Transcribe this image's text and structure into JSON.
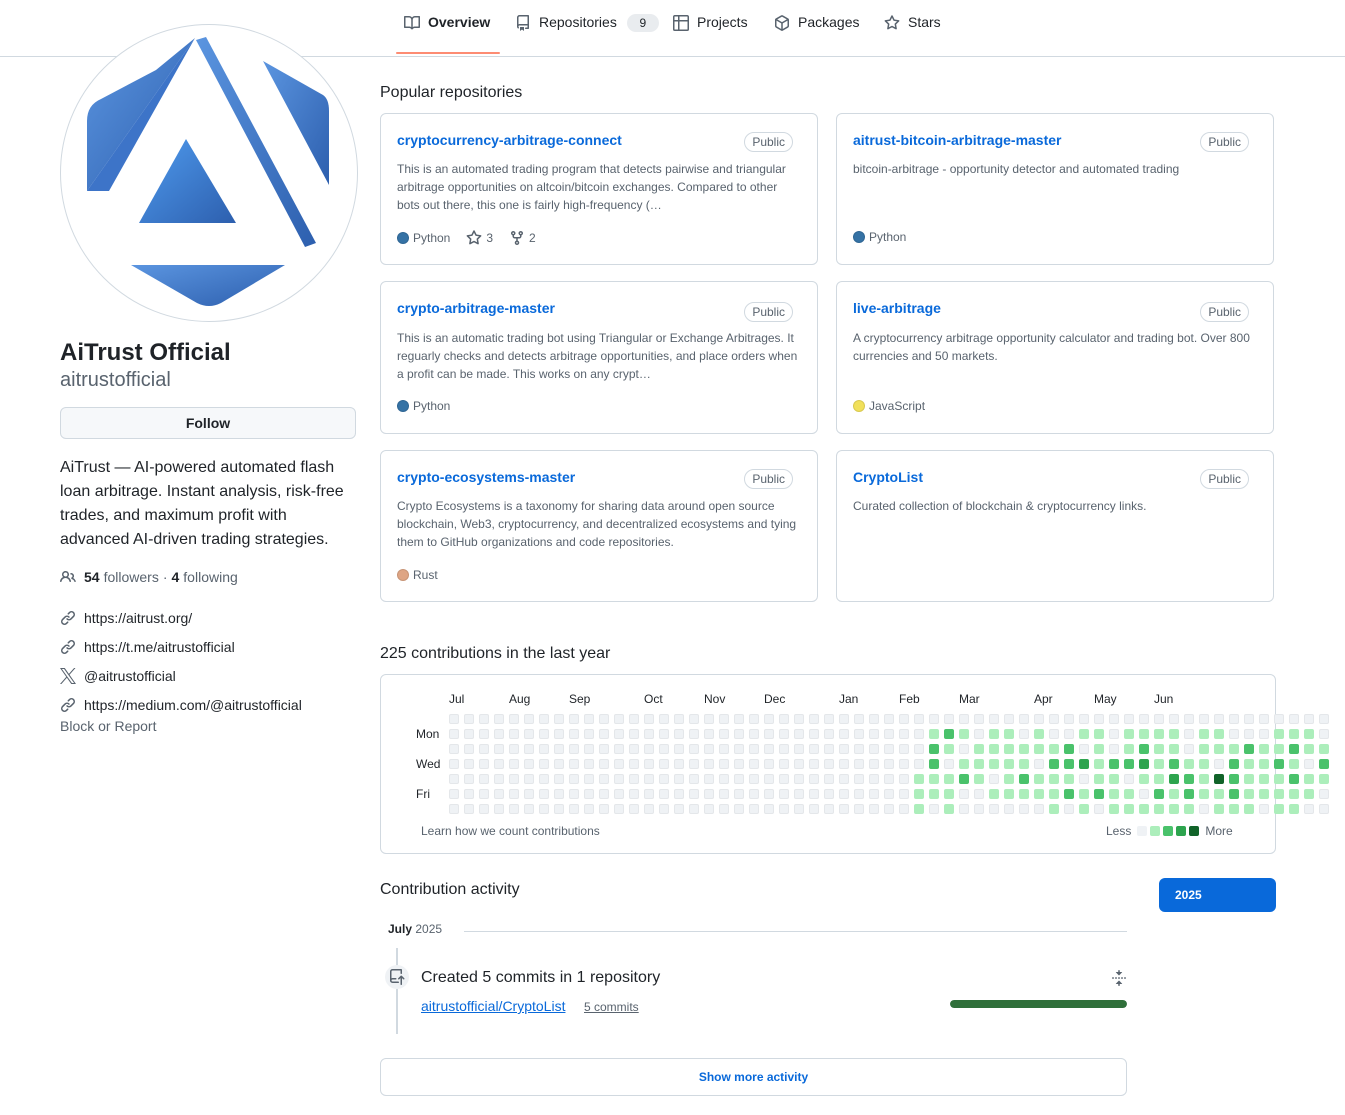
{
  "nav": {
    "tabs": [
      {
        "label": "Overview",
        "icon": "book-icon"
      },
      {
        "label": "Repositories",
        "count": "9",
        "icon": "repo-icon"
      },
      {
        "label": "Projects",
        "icon": "table-icon"
      },
      {
        "label": "Packages",
        "icon": "package-icon"
      },
      {
        "label": "Stars",
        "icon": "star-icon"
      }
    ],
    "active_tab": "Overview"
  },
  "profile": {
    "name": "AiTrust Official",
    "login": "aitrustofficial",
    "follow_label": "Follow",
    "bio": "AiTrust — AI-powered automated flash loan arbitrage. Instant analysis, risk-free trades, and maximum profit with advanced AI-driven trading strategies.",
    "followers_count": "54",
    "followers_label": "followers",
    "separator": "·",
    "following_count": "4",
    "following_label": "following",
    "links": [
      {
        "icon": "link-icon",
        "text": "https://aitrust.org/"
      },
      {
        "icon": "link-icon",
        "text": "https://t.me/aitrustofficial"
      },
      {
        "icon": "x-logo-icon",
        "text": "@aitrustofficial"
      },
      {
        "icon": "link-icon",
        "text": "https://medium.com/@aitrustofficial"
      }
    ],
    "block_label": "Block or Report"
  },
  "popular": {
    "title": "Popular repositories",
    "repos": [
      {
        "name": "cryptocurrency-arbitrage-connect",
        "visibility": "Public",
        "description": "This is an automated trading program that detects pairwise and triangular arbitrage opportunities on altcoin/bitcoin exchanges. Compared to other bots out there, this one is fairly high-frequency (…",
        "language": "Python",
        "lang_color": "#3572A5",
        "stars": "3",
        "forks": "2"
      },
      {
        "name": "aitrust-bitcoin-arbitrage-master",
        "visibility": "Public",
        "description": "bitcoin-arbitrage - opportunity detector and automated trading",
        "language": "Python",
        "lang_color": "#3572A5"
      },
      {
        "name": "crypto-arbitrage-master",
        "visibility": "Public",
        "description": "This is an automatic trading bot using Triangular or Exchange Arbitrages. It reguarly checks and detects arbitrage opportunities, and place orders when a profit can be made. This works on any crypt…",
        "language": "Python",
        "lang_color": "#3572A5"
      },
      {
        "name": "live-arbitrage",
        "visibility": "Public",
        "description": "A cryptocurrency arbitrage opportunity calculator and trading bot. Over 800 currencies and 50 markets.",
        "language": "JavaScript",
        "lang_color": "#f1e05a"
      },
      {
        "name": "crypto-ecosystems-master",
        "visibility": "Public",
        "description": "Crypto Ecosystems is a taxonomy for sharing data around open source blockchain, Web3, cryptocurrency, and decentralized ecosystems and tying them to GitHub organizations and code repositories.",
        "language": "Rust",
        "lang_color": "#dea584"
      },
      {
        "name": "CryptoList",
        "visibility": "Public",
        "description": "Curated collection of blockchain & cryptocurrency links."
      }
    ]
  },
  "contributions": {
    "title": "225 contributions in the last year",
    "months": [
      "Jul",
      "Aug",
      "Sep",
      "Oct",
      "Nov",
      "Dec",
      "Jan",
      "Feb",
      "Mar",
      "Apr",
      "May",
      "Jun"
    ],
    "days": [
      "Mon",
      "Wed",
      "Fri"
    ],
    "learn_label": "Learn how we count contributions",
    "legend_less": "Less",
    "legend_more": "More",
    "level_colors": [
      "#eff2f5",
      "#aceebb",
      "#4ac26b",
      "#2da44e",
      "#116329"
    ],
    "weeks_levels": [
      "0000000",
      "0000000",
      "0000000",
      "0000000",
      "0000000",
      "0000000",
      "0000000",
      "0000000",
      "0000000",
      "0000000",
      "0000000",
      "0000000",
      "0000000",
      "0000000",
      "0000000",
      "0000000",
      "0000000",
      "0000000",
      "0000000",
      "0000000",
      "0000000",
      "0000000",
      "0000000",
      "0000000",
      "0000000",
      "0000000",
      "0000000",
      "0000000",
      "0000000",
      "0000000",
      "0000000",
      "0000111",
      "0122110",
      "0210111",
      "0101200",
      "0011100",
      "0111010",
      "0111110",
      "0011210",
      "0110110",
      "0012111",
      "0022120",
      "0103011",
      "0111120",
      "0002111",
      "0112011",
      "0123101",
      "0111121",
      "0112311",
      "0001221",
      "0111110",
      "0110411",
      "0012221",
      "0021111",
      "0011110",
      "0112111",
      "0121211",
      "0110110",
      "0012100"
    ]
  },
  "activity": {
    "title": "Contribution activity",
    "year": "2025",
    "month_name": "July",
    "month_year": "2025",
    "summary": "Created 5 commits in 1 repository",
    "repo": "aitrustofficial/CryptoList",
    "commits": "5 commits",
    "progress": 1.0,
    "show_more": "Show more activity"
  }
}
